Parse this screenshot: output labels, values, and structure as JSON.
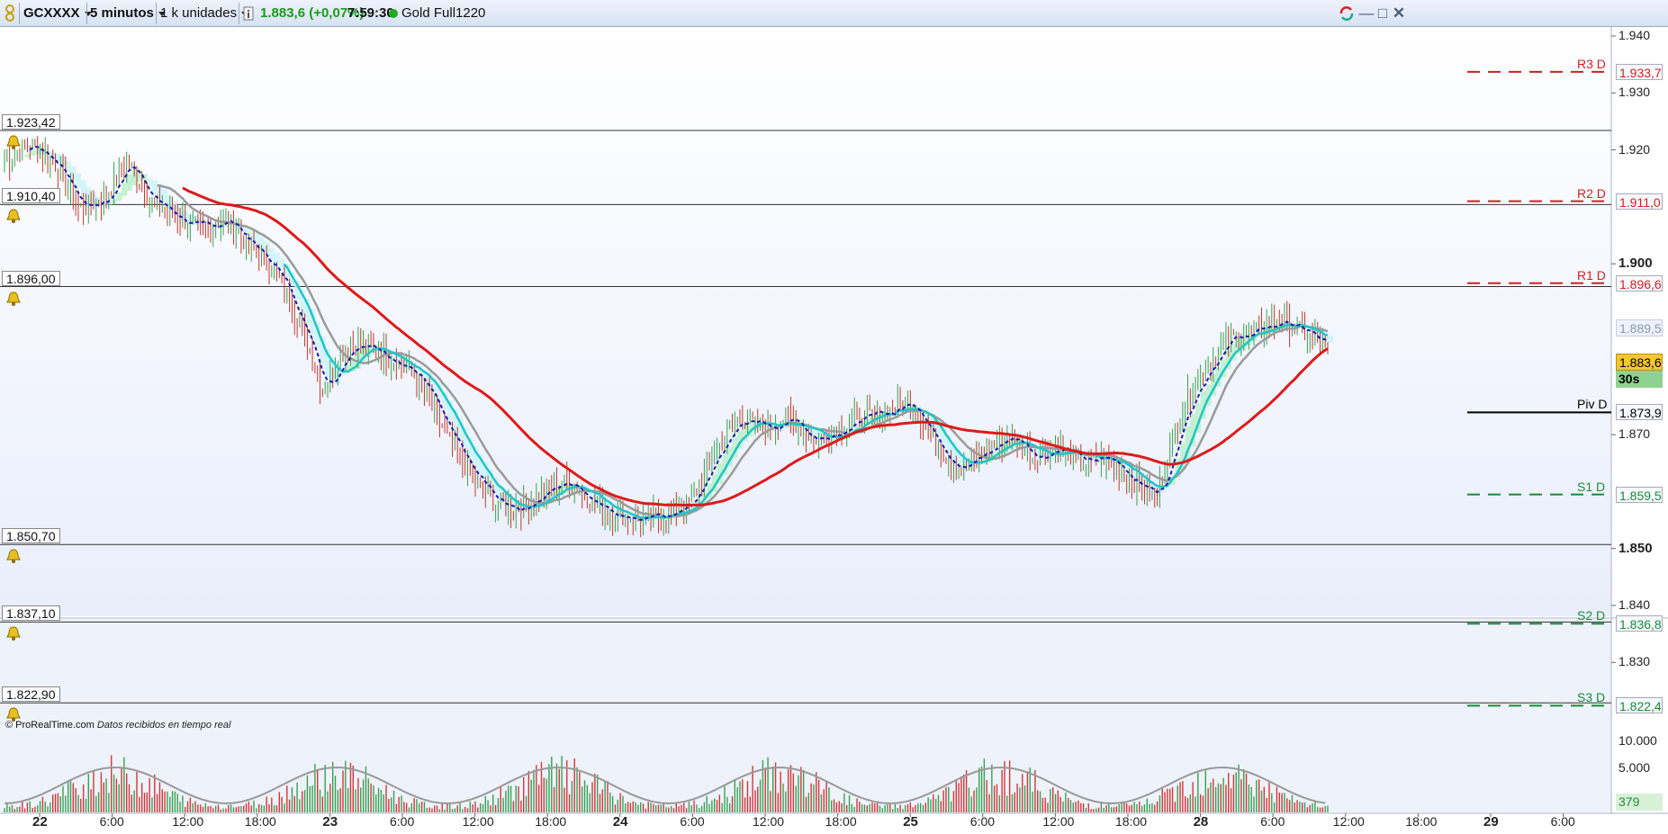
{
  "toolbar": {
    "symbol": "GCXXXX",
    "timeframe": "5 minutos",
    "units": "1 k unidades",
    "info_icon": "info-icon",
    "price_change": "1.883,6 (+0,07%)",
    "time": "7:59:30",
    "instrument": "Gold Full1220",
    "status_color": "#22aa22",
    "price_color": "#1a9a1a"
  },
  "alerts": [
    {
      "label": "1.923,42",
      "value": 1923.42
    },
    {
      "label": "1.910,40",
      "value": 1910.4
    },
    {
      "label": "1.896,00",
      "value": 1896.0
    },
    {
      "label": "1.850,70",
      "value": 1850.7
    },
    {
      "label": "1.837,10",
      "value": 1837.1
    },
    {
      "label": "1.822,90",
      "value": 1822.9
    }
  ],
  "pivots": [
    {
      "name": "R3 D",
      "value_label": "1.933,7",
      "value": 1933.7,
      "color": "#cc2222"
    },
    {
      "name": "R2 D",
      "value_label": "1.911,0",
      "value": 1911.0,
      "color": "#cc2222"
    },
    {
      "name": "R1 D",
      "value_label": "1.896,6",
      "value": 1896.6,
      "color": "#cc2222"
    },
    {
      "name": "Piv D",
      "value_label": "1.873,9",
      "value": 1873.9,
      "color": "#000000"
    },
    {
      "name": "S1 D",
      "value_label": "1.859,5",
      "value": 1859.5,
      "color": "#1a8a3a"
    },
    {
      "name": "S2 D",
      "value_label": "1.836,8",
      "value": 1836.8,
      "color": "#1a8a3a"
    },
    {
      "name": "S3 D",
      "value_label": "1.822,4",
      "value": 1822.4,
      "color": "#1a8a3a"
    }
  ],
  "current_price": {
    "label": "1.883,6",
    "value": 1883.6,
    "countdown": "30s"
  },
  "ma_labels": {
    "gray": "1.889,5"
  },
  "y_axis": {
    "ticks": [
      {
        "label": "1.940",
        "value": 1940,
        "bold": false
      },
      {
        "label": "1.930",
        "value": 1930,
        "bold": false
      },
      {
        "label": "1.920",
        "value": 1920,
        "bold": false
      },
      {
        "label": "1.900",
        "value": 1900,
        "bold": true
      },
      {
        "label": "1.870",
        "value": 1870,
        "bold": false
      },
      {
        "label": "1.850",
        "value": 1850,
        "bold": true
      },
      {
        "label": "1.840",
        "value": 1840,
        "bold": false
      },
      {
        "label": "1.830",
        "value": 1830,
        "bold": false
      }
    ]
  },
  "volume_axis": {
    "ticks": [
      {
        "label": "10.000"
      },
      {
        "label": "5.000"
      }
    ],
    "current": "379"
  },
  "x_axis": {
    "ticks": [
      {
        "label": "22",
        "bold": true
      },
      {
        "label": "6:00",
        "bold": false
      },
      {
        "label": "12:00",
        "bold": false
      },
      {
        "label": "18:00",
        "bold": false
      },
      {
        "label": "23",
        "bold": true
      },
      {
        "label": "6:00",
        "bold": false
      },
      {
        "label": "12:00",
        "bold": false
      },
      {
        "label": "18:00",
        "bold": false
      },
      {
        "label": "24",
        "bold": true
      },
      {
        "label": "6:00",
        "bold": false
      },
      {
        "label": "12:00",
        "bold": false
      },
      {
        "label": "18:00",
        "bold": false
      },
      {
        "label": "25",
        "bold": true
      },
      {
        "label": "6:00",
        "bold": false
      },
      {
        "label": "12:00",
        "bold": false
      },
      {
        "label": "18:00",
        "bold": false
      },
      {
        "label": "28",
        "bold": true
      },
      {
        "label": "6:00",
        "bold": false
      },
      {
        "label": "12:00",
        "bold": false
      },
      {
        "label": "18:00",
        "bold": false
      },
      {
        "label": "29",
        "bold": true
      },
      {
        "label": "6:00",
        "bold": false
      }
    ]
  },
  "footer": {
    "brand": "© ProRealTime.com",
    "status": "Datos recibidos en tiempo real"
  },
  "colors": {
    "background": "#eef2fb",
    "ma_red": "#dd1a1a",
    "ma_cyan": "#22c4c8",
    "ma_gray": "#9a9a9a",
    "ma_blue": "#1a1aa8"
  },
  "chart_data": {
    "type": "line",
    "price_range": [
      1818,
      1943
    ],
    "series": [
      {
        "values": [
          1918,
          1921,
          1918,
          1910,
          1911,
          1918,
          1911,
          1908,
          1906,
          1908,
          1903,
          1899,
          1890,
          1878,
          1886,
          1885,
          1883,
          1879,
          1870,
          1863,
          1858,
          1857,
          1860,
          1862,
          1858,
          1856,
          1855,
          1856,
          1858,
          1867,
          1873,
          1871,
          1873,
          1869,
          1871,
          1873,
          1874,
          1876,
          1868,
          1864,
          1867,
          1870,
          1866,
          1868,
          1865,
          1866,
          1862,
          1859,
          1874,
          1882,
          1887,
          1888,
          1890,
          1888,
          1885
        ]
      }
    ]
  }
}
